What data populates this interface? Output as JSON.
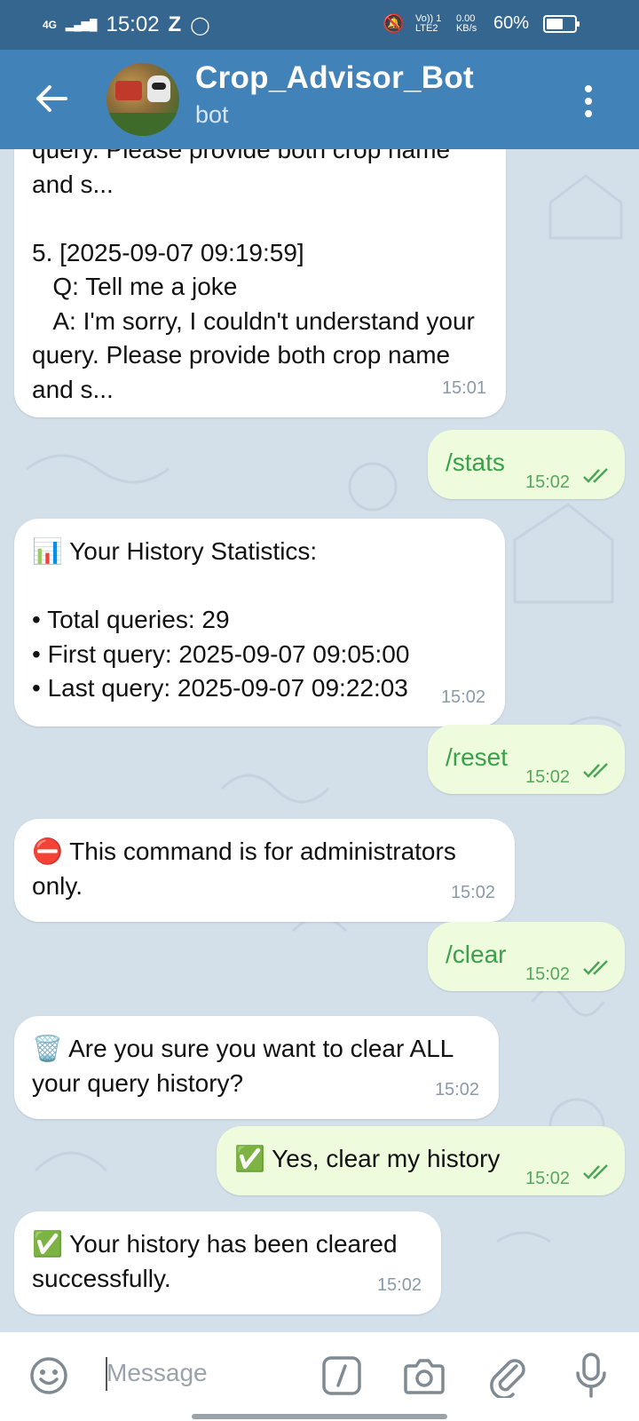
{
  "status_bar": {
    "network": "4G",
    "time": "15:02",
    "notif_z": "Z",
    "volte": "Vo)) 1 LTE2",
    "speed": "0.00 KB/s",
    "battery": "60%",
    "battery_level": 0.6
  },
  "header": {
    "title": "Crop_Advisor_Bot",
    "subtitle": "bot"
  },
  "messages": [
    {
      "from": "bot",
      "text": "query. Please provide both crop name\nand s...\n\n5. [2025-09-07 09:19:59]\n   Q: Tell me a joke\n   A: I'm sorry, I couldn't understand your query. Please provide both crop name and s...",
      "time": "15:01"
    },
    {
      "from": "me",
      "text": "/stats",
      "time": "15:02"
    },
    {
      "from": "bot",
      "text": "📊 Your History Statistics:\n\n• Total queries: 29\n• First query: 2025-09-07 09:05:00\n• Last query: 2025-09-07 09:22:03",
      "time": "15:02"
    },
    {
      "from": "me",
      "text": "/reset",
      "time": "15:02"
    },
    {
      "from": "bot",
      "text": "⛔ This command is for administrators only.",
      "time": "15:02"
    },
    {
      "from": "me",
      "text": "/clear",
      "time": "15:02"
    },
    {
      "from": "bot",
      "text": "🗑️ Are you sure you want to clear ALL your query history?",
      "time": "15:02"
    },
    {
      "from": "me",
      "text": "✅ Yes, clear my history",
      "time": "15:02"
    },
    {
      "from": "bot",
      "text": "✅ Your history has been cleared successfully.",
      "time": "15:02"
    }
  ],
  "composer": {
    "placeholder": "Message"
  },
  "colors": {
    "status_bar": "#35668f",
    "header": "#4182b8",
    "chat_bg": "#d3e0ea",
    "outgoing_bubble": "#eefbdd",
    "incoming_bubble": "#ffffff",
    "command_text": "#3aa14a"
  }
}
